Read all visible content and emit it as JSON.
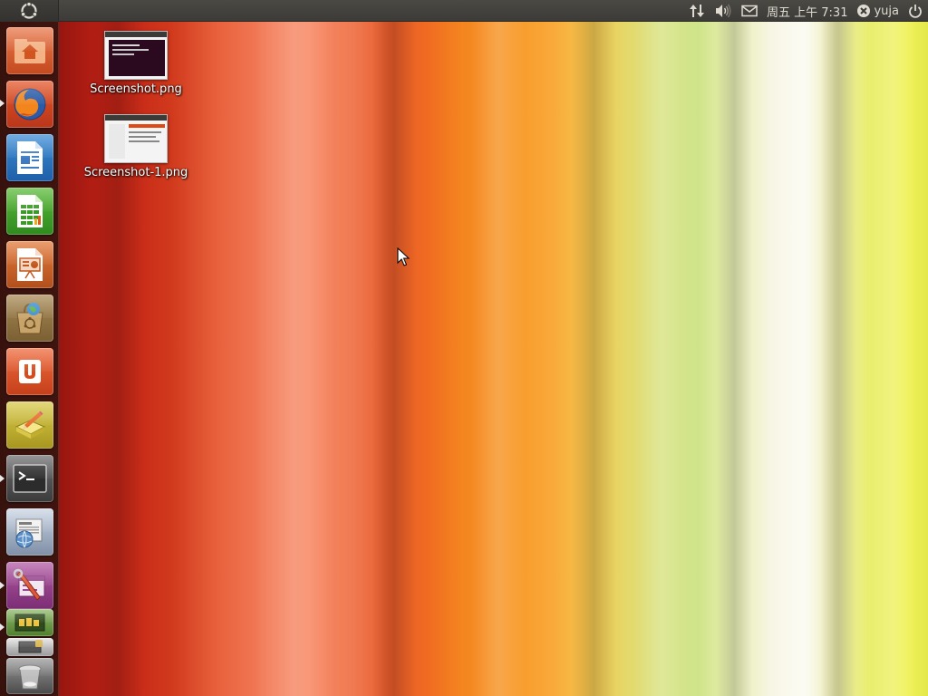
{
  "top_panel": {
    "clock": "周五 上午 7:31",
    "user": "yuja"
  },
  "desktop": {
    "icons": [
      {
        "label": "Screenshot.png"
      },
      {
        "label": "Screenshot-1.png"
      }
    ]
  },
  "launcher": {
    "items": [
      {
        "icon": "home-folder-icon",
        "running": false
      },
      {
        "icon": "firefox-icon",
        "running": true
      },
      {
        "icon": "libreoffice-writer-icon",
        "running": false
      },
      {
        "icon": "libreoffice-calc-icon",
        "running": false
      },
      {
        "icon": "libreoffice-impress-icon",
        "running": false
      },
      {
        "icon": "ubuntu-software-center-icon",
        "running": false
      },
      {
        "icon": "ubuntu-one-icon",
        "running": false
      },
      {
        "icon": "text-editor-icon",
        "running": false
      },
      {
        "icon": "terminal-icon",
        "running": true
      },
      {
        "icon": "news-reader-icon",
        "running": false
      },
      {
        "icon": "system-settings-icon",
        "running": true
      },
      {
        "icon": "system-monitor-icon",
        "running": true
      },
      {
        "icon": "workspace-switcher-icon",
        "running": false
      },
      {
        "icon": "trash-icon",
        "running": false
      }
    ]
  },
  "colors": {
    "panel": "#3c3b37",
    "launcher_bg": "#2a1410",
    "accent": "#dd4814"
  }
}
